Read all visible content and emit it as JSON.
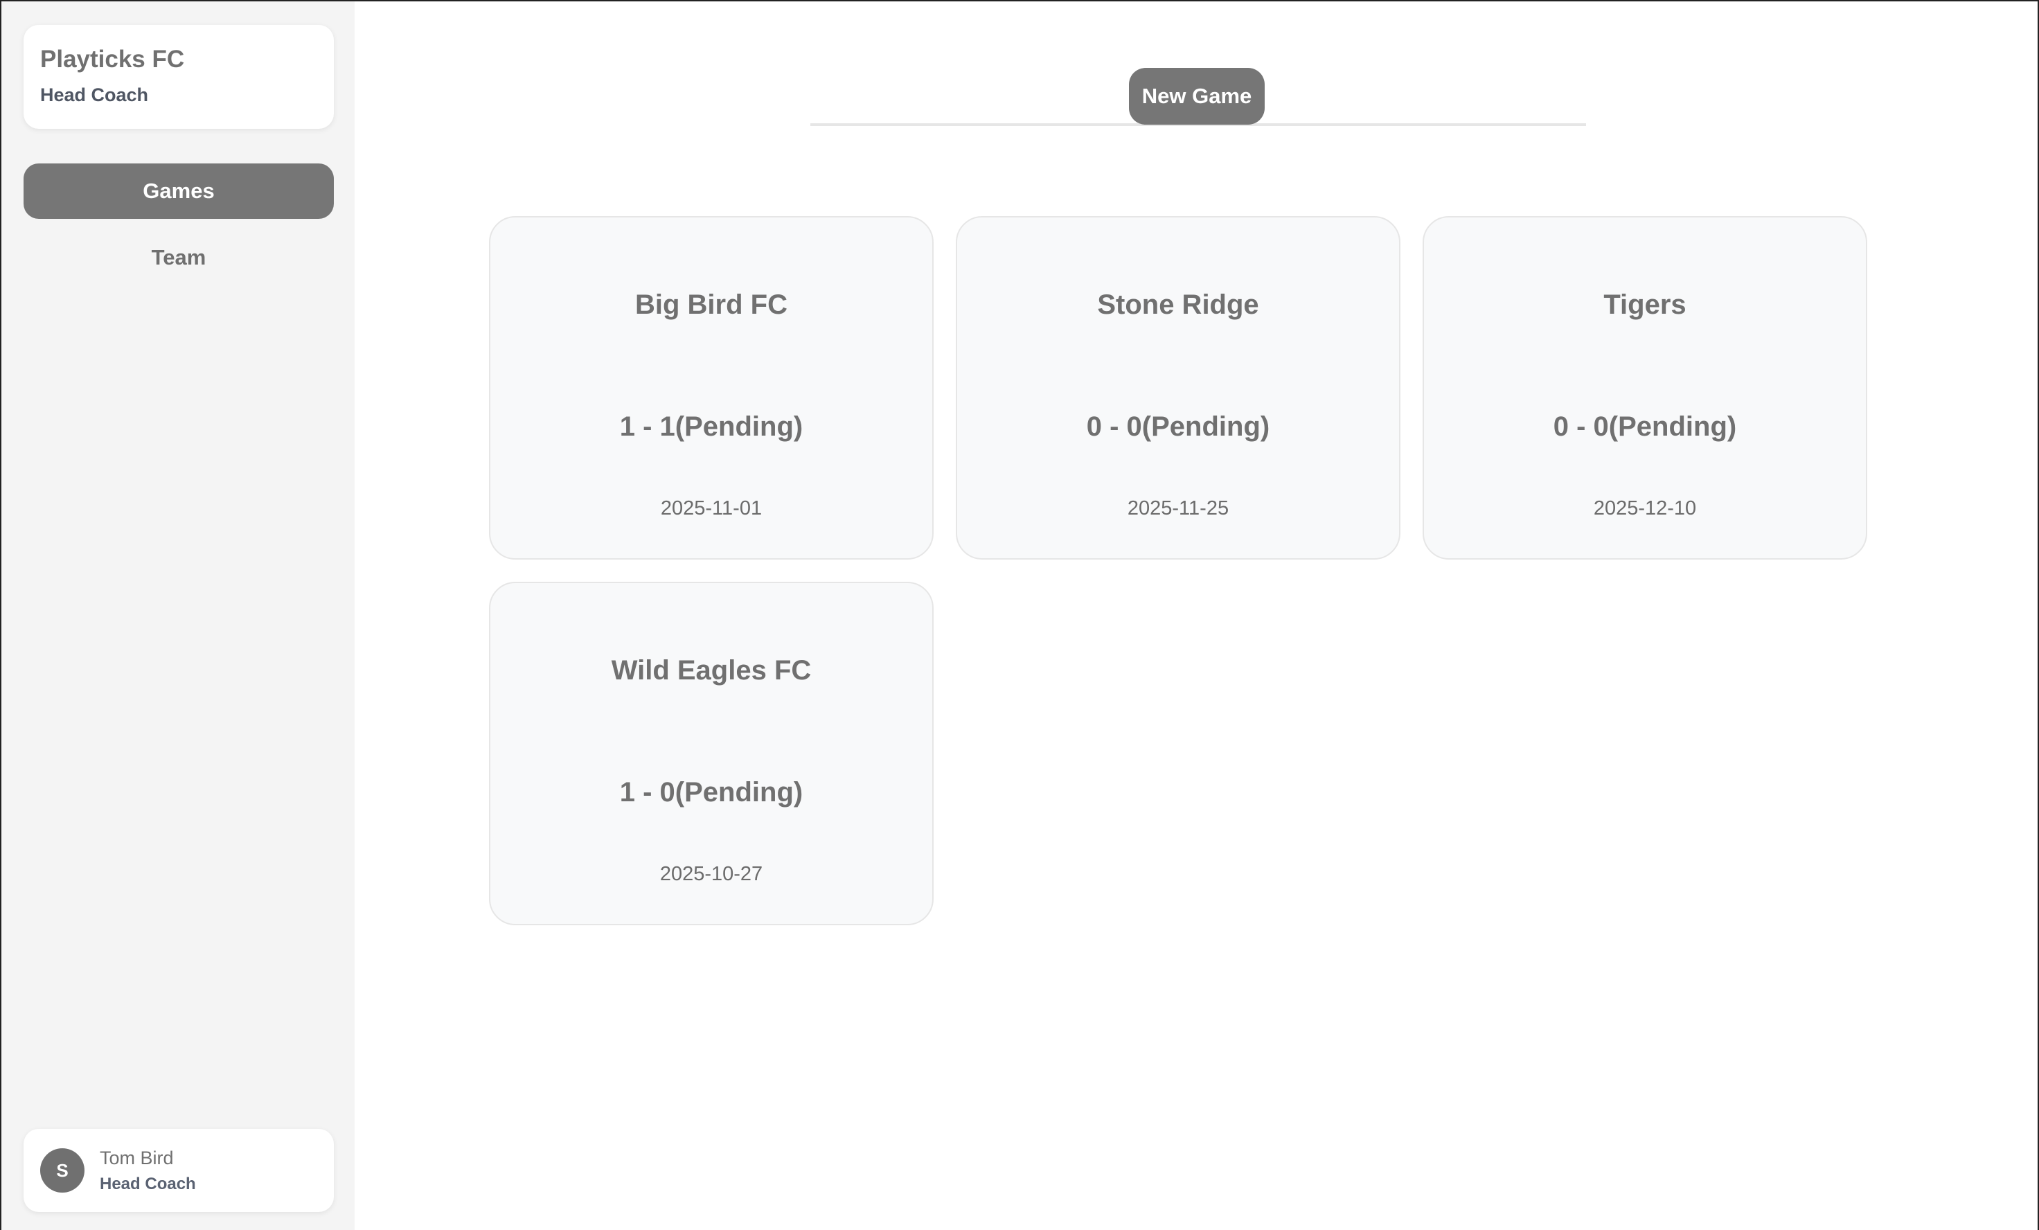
{
  "sidebar": {
    "brand": {
      "name": "Playticks FC",
      "role": "Head Coach"
    },
    "nav": [
      {
        "label": "Games",
        "active": true
      },
      {
        "label": "Team",
        "active": false
      }
    ],
    "user": {
      "initial": "S",
      "name": "Tom Bird",
      "role": "Head Coach"
    }
  },
  "main": {
    "new_game_label": "New Game",
    "games": [
      {
        "opponent": "Big Bird FC",
        "score": "1 - 1(Pending)",
        "date": "2025-11-01"
      },
      {
        "opponent": "Stone Ridge",
        "score": "0 - 0(Pending)",
        "date": "2025-11-25"
      },
      {
        "opponent": "Tigers",
        "score": "0 - 0(Pending)",
        "date": "2025-12-10"
      },
      {
        "opponent": "Wild Eagles FC",
        "score": "1 - 0(Pending)",
        "date": "2025-10-27"
      }
    ]
  },
  "colors": {
    "sidebar_bg": "#f4f4f4",
    "accent_gray": "#767676",
    "card_bg": "#f8f9fa",
    "card_border": "#e6e6e6"
  }
}
